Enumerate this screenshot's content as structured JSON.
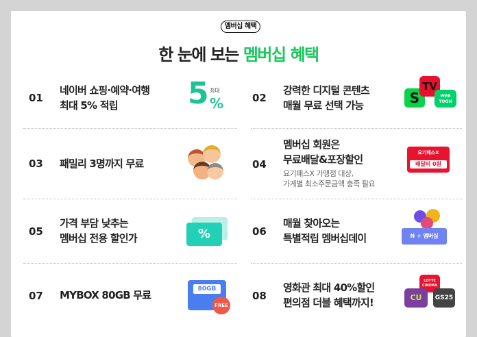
{
  "badge": "멤버십 혜택",
  "headline": {
    "prefix": "한 눈에 보는 ",
    "accent": "멤버십 혜택"
  },
  "colors": {
    "accent": "#19c85c",
    "background": "#d4d4d4"
  },
  "items": [
    {
      "num": "01",
      "line1": "네이버 쇼핑·예약·여행",
      "line2": "최대 5% 적립",
      "visual": {
        "label_small": "최대",
        "label_big": "5",
        "label_pct": "%"
      }
    },
    {
      "num": "02",
      "line1": "강력한 디지털 콘텐츠",
      "line2": "매월 무료 선택 가능",
      "visual": {
        "s": "S",
        "tv": "TV",
        "webtoon": "WEB TOON"
      }
    },
    {
      "num": "03",
      "line1": "패밀리 3명까지 무료",
      "line2": "",
      "visual": {
        "icon": "family-faces-icon"
      }
    },
    {
      "num": "04",
      "line1": "멤버십 회원은",
      "line2": "무료배달&포장할인",
      "sub1": "요기패스X 가맹점 대상,",
      "sub2": "가게별 최소주문금액 충족 필요",
      "visual": {
        "top": "요기패스X",
        "bottom": "배달비 0원"
      }
    },
    {
      "num": "05",
      "line1": "가격 부담 낮추는",
      "line2": "멤버십 전용 할인가",
      "visual": {
        "pct": "%"
      }
    },
    {
      "num": "06",
      "line1": "매월 찾아오는",
      "line2": "특별적립 멤버십데이",
      "visual": {
        "box": "N + 멤버십"
      }
    },
    {
      "num": "07",
      "line1": "MYBOX 80GB 무료",
      "line2": "",
      "visual": {
        "size": "80GB",
        "free": "FREE"
      }
    },
    {
      "num": "08",
      "line1": "영화관 최대 40%할인",
      "line2": "편의점 더블 혜택까지!",
      "visual": {
        "lotte": "LOTTE CINEMA",
        "cu": "CU",
        "gs": "GS25"
      }
    }
  ]
}
